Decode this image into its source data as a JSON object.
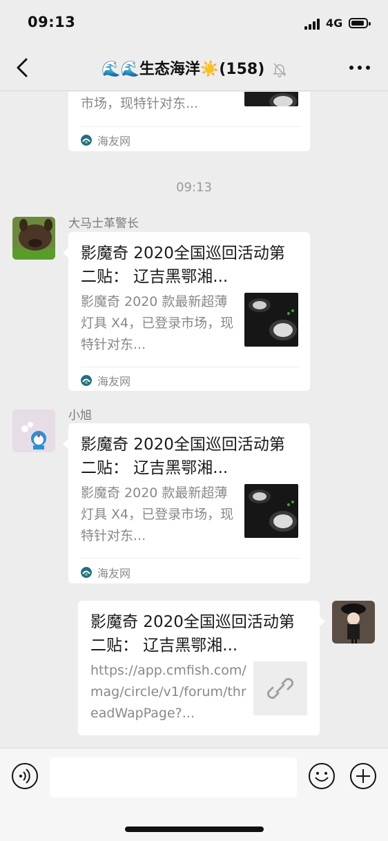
{
  "status_bar": {
    "time": "09:13",
    "network": "4G",
    "icons": [
      "signal-icon",
      "battery-icon"
    ]
  },
  "nav": {
    "title": "🌊🌊生态海洋☀️(158)",
    "icons": [
      "back-chevron-icon",
      "mute-bell-icon",
      "more-dots-icon"
    ]
  },
  "messages": {
    "card0": {
      "desc_tail": "市场，现特针对东...",
      "source": "海友网"
    },
    "timestamp": "09:13",
    "msg1": {
      "sender": "大马士革警长",
      "title": "影魔奇 2020全国巡回活动第二贴： 辽吉黑鄂湘...",
      "desc": "影魔奇 2020 款最新超薄灯具 X4，已登录市场，现特针对东...",
      "source": "海友网"
    },
    "msg2": {
      "sender": "小旭",
      "title": "影魔奇 2020全国巡回活动第二贴： 辽吉黑鄂湘...",
      "desc": "影魔奇 2020 款最新超薄灯具 X4，已登录市场，现特针对东...",
      "source": "海友网"
    },
    "msg3": {
      "title": "影魔奇 2020全国巡回活动第二贴： 辽吉黑鄂湘...",
      "desc": "https://app.cmfish.com/mag/circle/v1/forum/threadWapPage?...",
      "icon": "link-icon"
    }
  },
  "input_bar": {
    "placeholder": "",
    "icons": [
      "voice-icon",
      "emoji-icon",
      "plus-icon"
    ]
  },
  "colors": {
    "background": "#ededed",
    "bubble": "#ffffff",
    "secondary_text": "#888888",
    "source_icon": "#1f6f8b"
  }
}
